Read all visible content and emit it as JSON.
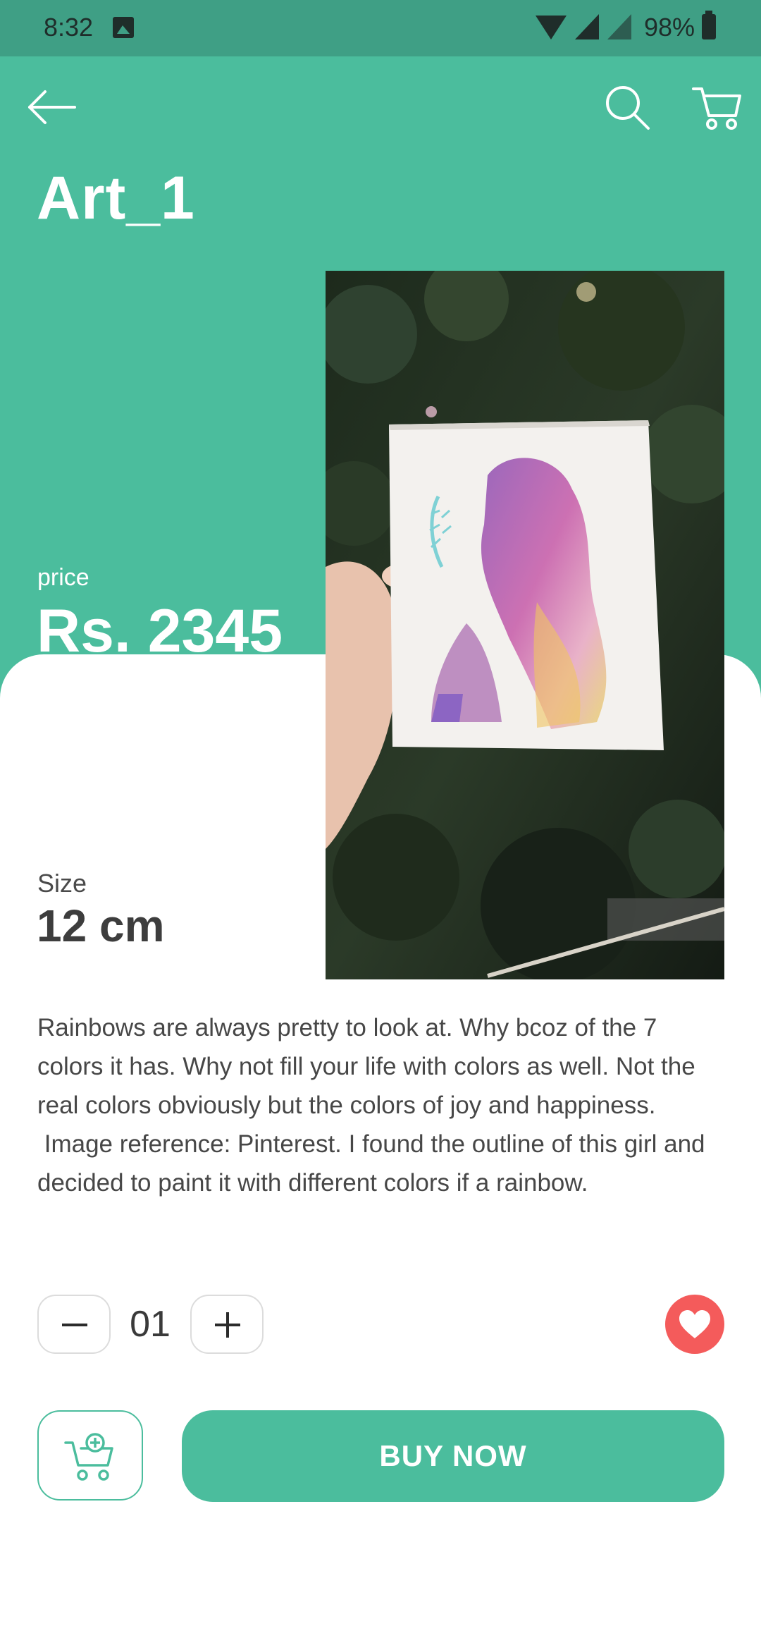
{
  "status_bar": {
    "time": "8:32",
    "battery": "98%",
    "icons": [
      "gallery-icon",
      "wifi-icon",
      "signal-icon",
      "battery-icon"
    ]
  },
  "nav": {
    "icons": [
      "arrow-back-icon",
      "search-icon",
      "cart-icon"
    ]
  },
  "product": {
    "title": "Art_1",
    "price_label": "price",
    "price": "Rs. 2345",
    "size_label": "Size",
    "size": "12 cm",
    "description": "Rainbows are always pretty to look at. Why bcoz of the 7 colors it has. Why not fill your life with colors as well. Not the real colors obviously but the colors of joy and happiness.\n Image reference: Pinterest. I found the outline of this girl and decided to paint it with different colors if a rainbow."
  },
  "quantity": {
    "value": "01"
  },
  "actions": {
    "buy_now_label": "BUY NOW",
    "add_to_cart_icon": "cart-plus-icon",
    "favorite_icon": "heart-icon"
  },
  "colors": {
    "accent": "#4bbd9d",
    "status_bar": "#3f9f85",
    "favorite": "#f45b5b",
    "text_dark": "#3d3d3d"
  }
}
